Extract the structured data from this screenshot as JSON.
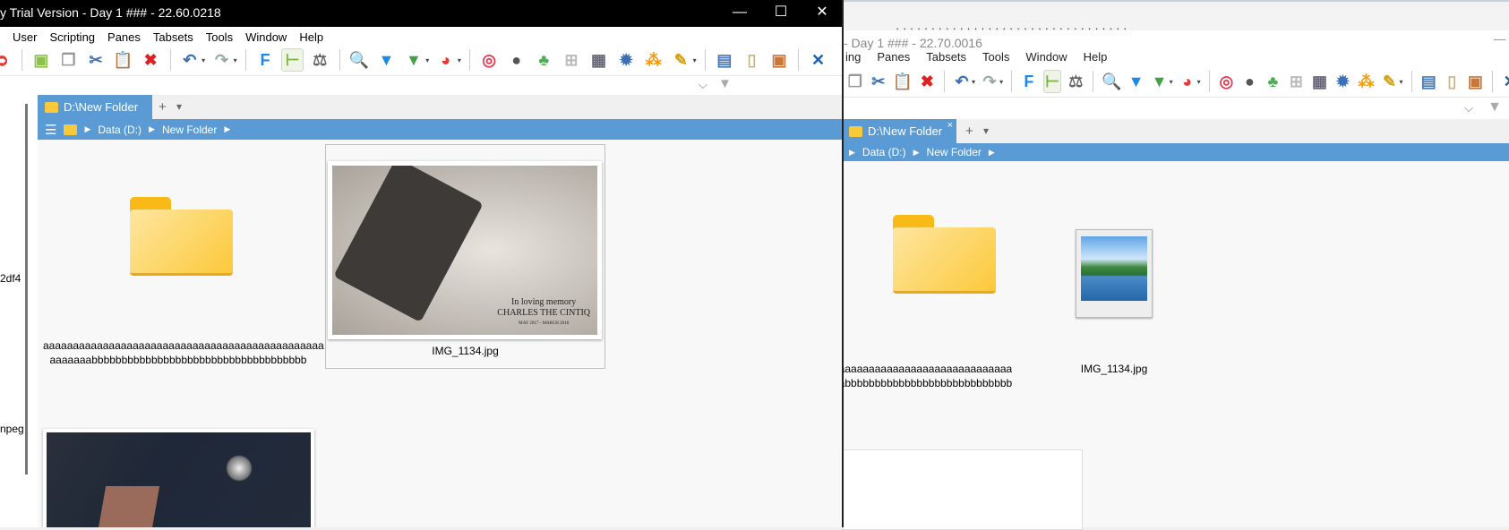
{
  "front_window": {
    "title": "y Trial Version - Day 1 ### - 22.60.0218",
    "controls": {
      "minimize": "—",
      "maximize": "☐",
      "close": "✕"
    },
    "menu": [
      "User",
      "Scripting",
      "Panes",
      "Tabsets",
      "Tools",
      "Window",
      "Help"
    ],
    "filter_dropdown": "⌵",
    "tab": {
      "label": "D:\\New Folder",
      "add": "+",
      "menu": "▾"
    },
    "breadcrumb": [
      "Data (D:)",
      "New Folder"
    ],
    "side_texts": [
      "2df4",
      "npeg"
    ],
    "items": [
      {
        "name": "aaaaaaaaaaaaaaaaaaaaaaaaaaaaaaaaaaaaaaaaaaaaaaaaaaaaabbbbbbbbbbbbbbbbbbbbbbbbbbbbbbbbbbbb",
        "line1": "aaaaaaaaaaaaaaaaaaaaaaaaaaaaaaaaaaaaaaaaaaaaaaa",
        "line2": "aaaaaaabbbbbbbbbbbbbbbbbbbbbbbbbbbbbbbbbbbb",
        "type": "folder"
      },
      {
        "name": "IMG_1134.jpg",
        "type": "image",
        "selected": true,
        "caption": {
          "l1": "In loving memory",
          "l2": "CHARLES THE CINTIQ",
          "l3": "MAY 2017 - MARCH 2018"
        }
      },
      {
        "name": "",
        "type": "image"
      }
    ]
  },
  "back_window": {
    "title": "- Day 1 ### - 22.70.0016",
    "menu": [
      "ing",
      "Panes",
      "Tabsets",
      "Tools",
      "Window",
      "Help"
    ],
    "tab": {
      "label": "D:\\New Folder",
      "close": "×",
      "add": "+",
      "menu": "▾"
    },
    "breadcrumb": [
      "Data (D:)",
      "New Folder"
    ],
    "items": [
      {
        "line1": "aaaaaaaaaaaaaaaaaaaaaaaaaaaaaaaaaaaaaaaaaaaaa",
        "line2": "aabbbbbbbbbbbbbbbbbbbbbbbbbbbbbbbbbbbbb",
        "type": "folder"
      },
      {
        "name": "IMG_1134.jpg",
        "type": "image"
      }
    ]
  },
  "toolbar_icons": [
    {
      "name": "new-folder-icon",
      "color": "#8bc34a",
      "glyph": "▣"
    },
    {
      "name": "copy-icon",
      "color": "#999",
      "glyph": "❐"
    },
    {
      "name": "cut-icon",
      "color": "#3b6fb6",
      "glyph": "✂"
    },
    {
      "name": "paste-icon",
      "color": "#b08a50",
      "glyph": "📋"
    },
    {
      "name": "delete-icon",
      "color": "#e02020",
      "glyph": "✖"
    },
    {
      "name": "undo-icon",
      "color": "#3b6fb6",
      "glyph": "↶"
    },
    {
      "name": "redo-icon",
      "color": "#9aa",
      "glyph": "↷"
    },
    {
      "name": "f-icon",
      "color": "#1e88e5",
      "glyph": "F"
    },
    {
      "name": "tree-view-icon",
      "color": "#7cb342",
      "glyph": "⊢"
    },
    {
      "name": "weight-icon",
      "color": "#666",
      "glyph": "⚖"
    },
    {
      "name": "search-icon",
      "color": "#1e88e5",
      "glyph": "🔍"
    },
    {
      "name": "filter-icon",
      "color": "#1e88e5",
      "glyph": "▼"
    },
    {
      "name": "filter-green-icon",
      "color": "#43a047",
      "glyph": "▼"
    },
    {
      "name": "pie-icon",
      "color": "#e53935",
      "glyph": "◕"
    },
    {
      "name": "spiral-icon",
      "color": "#e53950",
      "glyph": "◎"
    },
    {
      "name": "moon-icon",
      "color": "#555",
      "glyph": "●"
    },
    {
      "name": "tree-icon",
      "color": "#4caf50",
      "glyph": "♣"
    },
    {
      "name": "grid-icon",
      "color": "#bbb",
      "glyph": "⊞"
    },
    {
      "name": "table-icon",
      "color": "#667",
      "glyph": "▦"
    },
    {
      "name": "badge-icon",
      "color": "#3b6fb6",
      "glyph": "✹"
    },
    {
      "name": "colors-icon",
      "color": "#ff9800",
      "glyph": "⁂"
    },
    {
      "name": "brush-icon",
      "color": "#d4a017",
      "glyph": "✎"
    },
    {
      "name": "split-icon",
      "color": "#4a78b5",
      "glyph": "▤"
    },
    {
      "name": "panel-icon",
      "color": "#c8b48a",
      "glyph": "▯"
    },
    {
      "name": "frame-icon",
      "color": "#c8773a",
      "glyph": "▣"
    },
    {
      "name": "tools-icon",
      "color": "#1e5fa8",
      "glyph": "✕"
    }
  ],
  "colors": {
    "accent": "#5b9bd5",
    "titlebar": "#000000",
    "selection": "#99c9f0"
  }
}
